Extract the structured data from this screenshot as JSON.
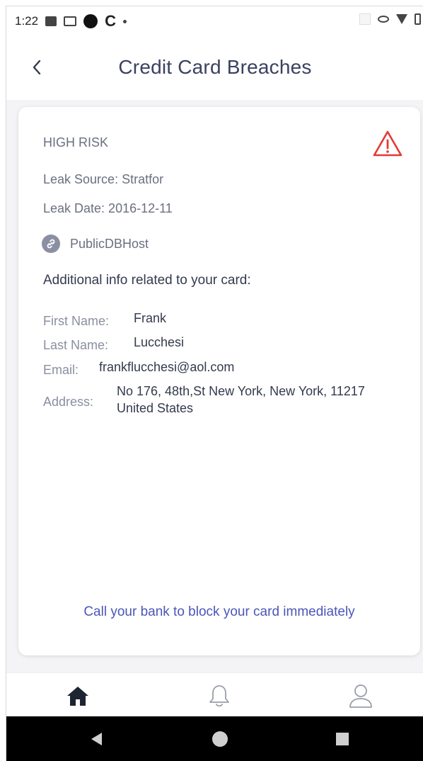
{
  "status_bar": {
    "time": "1:22",
    "c_glyph": "C"
  },
  "header": {
    "title": "Credit Card Breaches",
    "back_icon": "chevron-left-icon"
  },
  "breach": {
    "risk_level": "HIGH RISK",
    "risk_color": "#e53935",
    "leak_source": "Leak Source: Stratfor",
    "leak_date": "Leak Date:  2016-12-11",
    "host": "PublicDBHost",
    "additional_heading": "Additional info related to your card:",
    "fields": {
      "first_name_label": "First Name:",
      "first_name_value": "Frank",
      "last_name_label": "Last Name:",
      "last_name_value": "Lucchesi",
      "email_label": "Email:",
      "email_value": "frankflucchesi@aol.com",
      "address_label": "Address:",
      "address_line1": "No 176, 48th,St New York, New York, 11217",
      "address_line2": "United States"
    },
    "call_to_action": "Call your bank to block your card immediately"
  },
  "bottom_nav": {
    "items": [
      "home-icon",
      "bell-icon",
      "user-icon"
    ],
    "active": "home-icon"
  },
  "colors": {
    "accent": "#4a56b8",
    "title": "#3a4160",
    "warning": "#e53935"
  }
}
